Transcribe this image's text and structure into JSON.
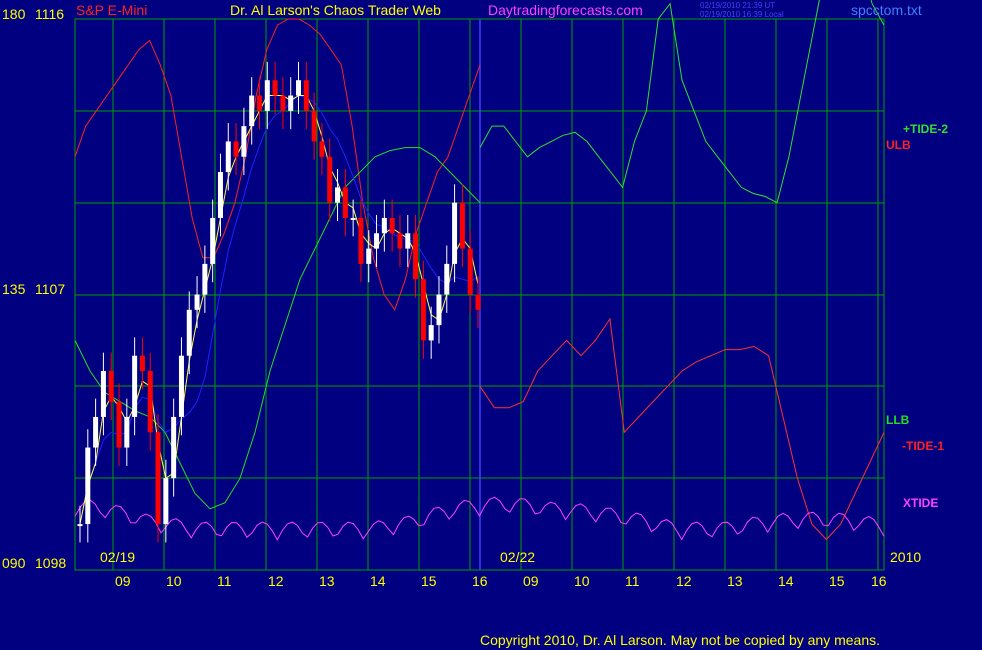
{
  "header": {
    "symbol": "S&P E-Mini",
    "title": "Dr. Al Larson's Chaos Trader Web",
    "site": "Daytradingforecasts.com",
    "stamp_ut": "02/19/2010 21:39 UT",
    "stamp_local": "02/19/2010 16:39 Local",
    "filename": "spcctom.txt"
  },
  "copyright": "Copyright 2010, Dr. Al Larson. May not be copied by any means.",
  "colors": {
    "background": "#000080",
    "grid": "#00A000",
    "price_up": "#FFFFFF",
    "price_down": "#FF0000",
    "ulb": "#FF2020",
    "llb": "#20E020",
    "tide_upper": "#30E030",
    "tide_lower": "#FF3030",
    "xtide": "#FF40FF",
    "moving_avg_fast": "#FFFF40",
    "moving_avg_slow": "#2020FF",
    "marker_line": "#4040FF",
    "date_labels": "#FFFF00",
    "axis_labels": "#FFFF00",
    "symbol_color": "#FF2020",
    "title_color": "#FFFF00",
    "site_color": "#FF40FF",
    "filename_color": "#4080FF"
  },
  "chart_data": {
    "type": "line",
    "y_axis": {
      "left_labels": [
        {
          "cycle": "180",
          "price": "1116"
        },
        {
          "cycle": "135",
          "price": "1107"
        },
        {
          "cycle": "090",
          "price": "1098"
        }
      ],
      "price_range": [
        1098,
        1116
      ]
    },
    "x_axis": {
      "hour_ticks": [
        "09",
        "10",
        "11",
        "12",
        "13",
        "14",
        "15",
        "16",
        "09",
        "10",
        "11",
        "12",
        "13",
        "14",
        "15",
        "16"
      ],
      "date_labels": [
        "02/19",
        "02/22"
      ],
      "year_label": "2010"
    },
    "series_labels": [
      {
        "key": "tide_upper",
        "label": "+TIDE-2"
      },
      {
        "key": "ulb",
        "label": "ULB"
      },
      {
        "key": "llb",
        "label": "LLB"
      },
      {
        "key": "tide_lower",
        "label": "-TIDE-1"
      },
      {
        "key": "xtide",
        "label": "XTIDE"
      }
    ],
    "series": {
      "price_close": [
        1099.5,
        1102,
        1103,
        1104.5,
        1103.5,
        1102,
        1103,
        1105,
        1104.5,
        1102.5,
        1099.5,
        1101,
        1103,
        1105,
        1106.5,
        1107,
        1108,
        1109.5,
        1111,
        1112,
        1111.5,
        1112.5,
        1113.5,
        1113,
        1114,
        1113.5,
        1113,
        1113.5,
        1114,
        1113,
        1112,
        1111.5,
        1110,
        1110.5,
        1109.5,
        1109.5,
        1108,
        1108.5,
        1109,
        1109.5,
        1109,
        1108.5,
        1109,
        1107.5,
        1105.5,
        1106,
        1107,
        1108,
        1110,
        1108.5,
        1107,
        1106.5
      ],
      "ulb": [
        1111.5,
        1112.5,
        1113,
        1113.5,
        1114,
        1114.5,
        1115,
        1115.3,
        1114.5,
        1113.5,
        1111.5,
        1109.5,
        1108.2,
        1108.2,
        1109,
        1110,
        1111.5,
        1113.5,
        1115,
        1115.8,
        1116,
        1116,
        1115.8,
        1115.5,
        1115,
        1114.5,
        1112.5,
        1110,
        1108.2,
        1107,
        1106.5,
        1107.5,
        1109,
        1110,
        1111,
        1111.5,
        1112.5,
        1113.5,
        1114.5
      ],
      "llb": [
        1105.5,
        1104.5,
        1103.8,
        1103.5,
        1103.2,
        1103,
        1102.5,
        1101.5,
        1100.5,
        1100,
        1100.2,
        1101,
        1102.5,
        1104.5,
        1106,
        1107.5,
        1108.5,
        1109.5,
        1110.5,
        1111,
        1111.5,
        1111.7,
        1111.8,
        1111.8,
        1111.5,
        1111,
        1110.5,
        1110
      ],
      "plus_tide": [
        1111.8,
        1112.5,
        1112.5,
        1112,
        1111.5,
        1111.8,
        1112,
        1112.2,
        1112.3,
        1112,
        1111.5,
        1111,
        1110.5,
        1112,
        1113,
        1116,
        1116.5,
        1114,
        1113,
        1112,
        1111.5,
        1111,
        1110.5,
        1110.3,
        1110.2,
        1110,
        1111.5,
        1113.5,
        1115.5,
        1117.5,
        1118.5,
        1119,
        1118,
        1116.5,
        1115.8
      ],
      "minus_tide": [
        1104,
        1103.3,
        1103.3,
        1103.5,
        1104.5,
        1105,
        1105.5,
        1105,
        1105.5,
        1106.2,
        1102.5,
        1103,
        1103.5,
        1104,
        1104.5,
        1104.8,
        1105,
        1105.2,
        1105.2,
        1105.3,
        1105,
        1103,
        1101,
        1099.5,
        1099,
        1099.5,
        1100.5,
        1101.5,
        1102.5
      ],
      "xtide_note": "oscillator plotted in lower band"
    }
  }
}
